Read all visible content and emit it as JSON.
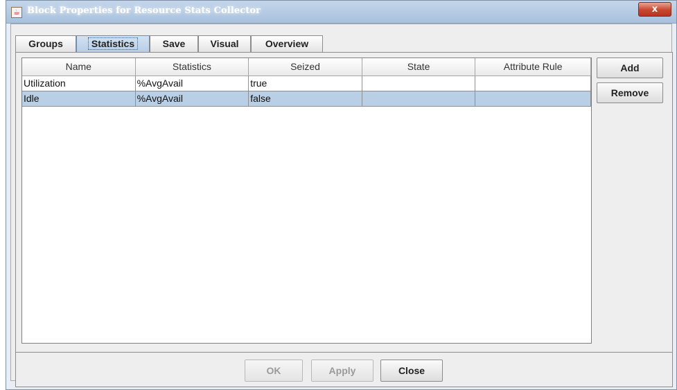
{
  "window": {
    "title": "Block Properties for Resource Stats Collector",
    "close_glyph": "x"
  },
  "tabs": [
    {
      "label": "Groups",
      "selected": false
    },
    {
      "label": "Statistics",
      "selected": true
    },
    {
      "label": "Save",
      "selected": false
    },
    {
      "label": "Visual",
      "selected": false
    },
    {
      "label": "Overview",
      "selected": false
    }
  ],
  "table": {
    "columns": [
      "Name",
      "Statistics",
      "Seized",
      "State",
      "Attribute Rule"
    ],
    "rows": [
      [
        "Utilization",
        "%AvgAvail",
        "true",
        "",
        ""
      ],
      [
        "Idle",
        "%AvgAvail",
        "false",
        "",
        ""
      ]
    ],
    "selected_row": 1
  },
  "side_buttons": {
    "add": "Add",
    "remove": "Remove"
  },
  "footer": {
    "ok": "OK",
    "ok_enabled": false,
    "apply": "Apply",
    "apply_enabled": false,
    "close": "Close"
  },
  "colors": {
    "selection": "#b9cfe5",
    "titlebar": "#a9c1dd"
  },
  "icons": {
    "app": "java-coffee-icon"
  }
}
